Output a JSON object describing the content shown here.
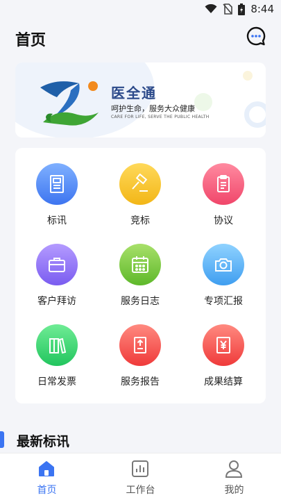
{
  "status": {
    "time": "8:44"
  },
  "header": {
    "title": "首页"
  },
  "banner": {
    "brand": "医全通",
    "slogan": "呵护生命，服务大众健康",
    "slogan_en": "CARE FOR LIFE, SERVE THE PUBLIC HEALTH"
  },
  "grid": [
    {
      "label": "标讯",
      "icon": "document-icon",
      "color_top": "#7fb0ff",
      "color_bottom": "#3d75f0"
    },
    {
      "label": "竞标",
      "icon": "gavel-icon",
      "color_top": "#ffd95a",
      "color_bottom": "#f2b617"
    },
    {
      "label": "协议",
      "icon": "clipboard-icon",
      "color_top": "#ff8aa0",
      "color_bottom": "#f0466a"
    },
    {
      "label": "客户拜访",
      "icon": "briefcase-icon",
      "color_top": "#b49bff",
      "color_bottom": "#7a5cf0"
    },
    {
      "label": "服务日志",
      "icon": "calendar-icon",
      "color_top": "#a8e06a",
      "color_bottom": "#5eb82a"
    },
    {
      "label": "专项汇报",
      "icon": "camera-icon",
      "color_top": "#8fd2ff",
      "color_bottom": "#3f9ef0"
    },
    {
      "label": "日常发票",
      "icon": "books-icon",
      "color_top": "#6fec95",
      "color_bottom": "#22c55e"
    },
    {
      "label": "服务报告",
      "icon": "upload-report-icon",
      "color_top": "#ff8a80",
      "color_bottom": "#ef3a3a"
    },
    {
      "label": "成果结算",
      "icon": "yen-document-icon",
      "color_top": "#ff8a80",
      "color_bottom": "#ef3a3a"
    }
  ],
  "section": {
    "title": "最新标讯"
  },
  "tabs": [
    {
      "label": "首页",
      "icon": "home-icon",
      "active": true
    },
    {
      "label": "工作台",
      "icon": "chart-icon",
      "active": false
    },
    {
      "label": "我的",
      "icon": "person-icon",
      "active": false
    }
  ],
  "colors": {
    "accent": "#3b74f2"
  }
}
